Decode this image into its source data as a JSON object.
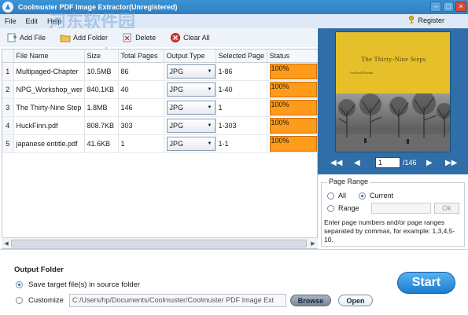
{
  "window": {
    "title": "Coolmuster PDF Image Extractor(Unregistered)",
    "controls": [
      "–",
      "□",
      "×"
    ]
  },
  "watermark": {
    "text": "河东软件园",
    "url": "www.pc0359.cn"
  },
  "menu": [
    "File",
    "Edit",
    "Help"
  ],
  "register_label": "Register",
  "toolbar": {
    "add_file": "Add File",
    "add_folder": "Add Folder",
    "delete": "Delete",
    "clear_all": "Clear All"
  },
  "table": {
    "columns": [
      "File Name",
      "Size",
      "Total Pages",
      "Output Type",
      "Selected Page",
      "Status"
    ],
    "rows": [
      {
        "num": "1",
        "name": "Multipaged-Chapter",
        "size": "10.5MB",
        "pages": "86",
        "type": "JPG",
        "selected": "1-86",
        "status": "100%"
      },
      {
        "num": "2",
        "name": "NPG_Workshop_wer",
        "size": "840.1KB",
        "pages": "40",
        "type": "JPG",
        "selected": "1-40",
        "status": "100%"
      },
      {
        "num": "3",
        "name": "The Thirty-Nine Step",
        "size": "1.8MB",
        "pages": "146",
        "type": "JPG",
        "selected": "1",
        "status": "100%"
      },
      {
        "num": "4",
        "name": "HuckFinn.pdf",
        "size": "808.7KB",
        "pages": "303",
        "type": "JPG",
        "selected": "1-303",
        "status": "100%"
      },
      {
        "num": "5",
        "name": "japanese entitle.pdf",
        "size": "41.6KB",
        "pages": "1",
        "type": "JPG",
        "selected": "1-1",
        "status": "100%"
      }
    ]
  },
  "preview": {
    "book_title": "The Thirty-Nine Steps",
    "book_author": "Archibald Buchan",
    "current_page": "1",
    "total_pages": "/146"
  },
  "page_range": {
    "legend": "Page Range",
    "all_label": "All",
    "current_label": "Current",
    "range_label": "Range",
    "ok_label": "Ok",
    "selected": "Current",
    "help": "Enter page numbers and/or page ranges separated by commas, for example: 1,3,4,5-10."
  },
  "output": {
    "title": "Output Folder",
    "source_label": "Save target file(s) in source folder",
    "customize_label": "Customize",
    "path": "C:/Users/hp/Documents/Coolmuster/Coolmuster PDF Image Ext",
    "browse_label": "Browse",
    "open_label": "Open",
    "selected": "source"
  },
  "start_label": "Start",
  "colors": {
    "title_bar": "#2f7fc0",
    "panel_blue": "#2f6ea8",
    "status_orange": "#ff9b1a",
    "start_blue": "#1d7ccf"
  }
}
